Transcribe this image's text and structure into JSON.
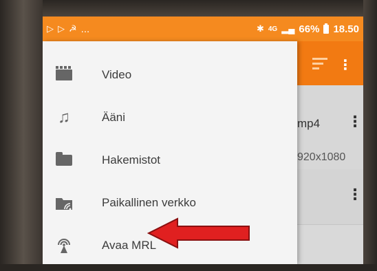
{
  "status_bar": {
    "left_icons": [
      "play-store-icon",
      "play-store-icon",
      "notification-icon"
    ],
    "ellipsis": "...",
    "network": "4G",
    "battery_percent": "66%",
    "time": "18.50"
  },
  "drawer": {
    "items": [
      {
        "label": "Video",
        "icon": "clapperboard-icon"
      },
      {
        "label": "Ääni",
        "icon": "music-note-icon"
      },
      {
        "label": "Hakemistot",
        "icon": "folder-icon"
      },
      {
        "label": "Paikallinen verkko",
        "icon": "network-folder-icon"
      },
      {
        "label": "Avaa MRL",
        "icon": "broadcast-icon"
      }
    ]
  },
  "background_list": {
    "item1": {
      "filename": "mp4",
      "resolution": "920x1080"
    }
  },
  "colors": {
    "accent": "#f58a1f",
    "toolbar": "#f27a12",
    "drawer_bg": "#f4f4f4",
    "arrow": "#e02020"
  }
}
